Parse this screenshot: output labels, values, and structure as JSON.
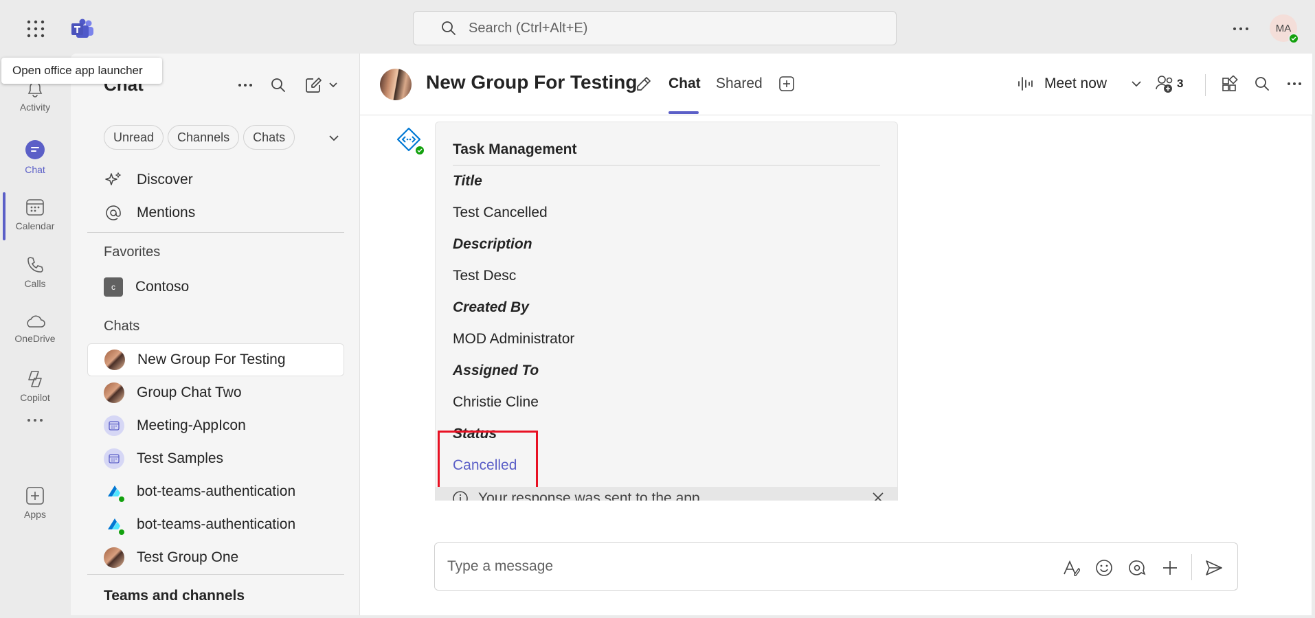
{
  "tooltip": {
    "text": "Open office app launcher"
  },
  "search": {
    "placeholder": "Search (Ctrl+Alt+E)"
  },
  "user": {
    "initials": "MA"
  },
  "rail": {
    "items": [
      {
        "label": "Activity",
        "icon": "bell-icon"
      },
      {
        "label": "Chat",
        "icon": "chat-icon",
        "active": true
      },
      {
        "label": "Calendar",
        "icon": "calendar-icon"
      },
      {
        "label": "Calls",
        "icon": "phone-icon"
      },
      {
        "label": "OneDrive",
        "icon": "cloud-icon"
      },
      {
        "label": "Copilot",
        "icon": "copilot-icon"
      },
      {
        "label": "Apps",
        "icon": "add-app-icon"
      }
    ]
  },
  "panel": {
    "title": "Chat",
    "filters": [
      "Unread",
      "Channels",
      "Chats"
    ],
    "nav": [
      {
        "label": "Discover",
        "icon": "sparkle-icon"
      },
      {
        "label": "Mentions",
        "icon": "at-icon"
      }
    ],
    "favorites_label": "Favorites",
    "favorites": [
      {
        "label": "Contoso",
        "initial": "c"
      }
    ],
    "chats_label": "Chats",
    "chats": [
      {
        "label": "New Group For Testing",
        "avatar": "photo",
        "selected": true
      },
      {
        "label": "Group Chat Two",
        "avatar": "photo"
      },
      {
        "label": "Meeting-AppIcon",
        "avatar": "calendar"
      },
      {
        "label": "Test Samples",
        "avatar": "calendar"
      },
      {
        "label": "bot-teams-authentication",
        "avatar": "bot"
      },
      {
        "label": "bot-teams-authentication",
        "avatar": "bot"
      },
      {
        "label": "Test Group One",
        "avatar": "photo"
      }
    ],
    "teams_label": "Teams and channels"
  },
  "header": {
    "title": "New Group For Testing",
    "tabs": [
      "Chat",
      "Shared"
    ],
    "meet_label": "Meet now",
    "participants": "3"
  },
  "card": {
    "title": "Task Management",
    "fields": [
      {
        "label": "Title",
        "value": "Test Cancelled"
      },
      {
        "label": "Description",
        "value": "Test Desc"
      },
      {
        "label": "Created By",
        "value": "MOD Administrator"
      },
      {
        "label": "Assigned To",
        "value": "Christie Cline"
      },
      {
        "label": "Status",
        "value": "Cancelled"
      }
    ],
    "response_text": "Your response was sent to the app"
  },
  "composer": {
    "placeholder": "Type a message"
  },
  "colors": {
    "accent": "#5b5fc7",
    "presence": "#13a10e",
    "highlight": "#e81123"
  }
}
